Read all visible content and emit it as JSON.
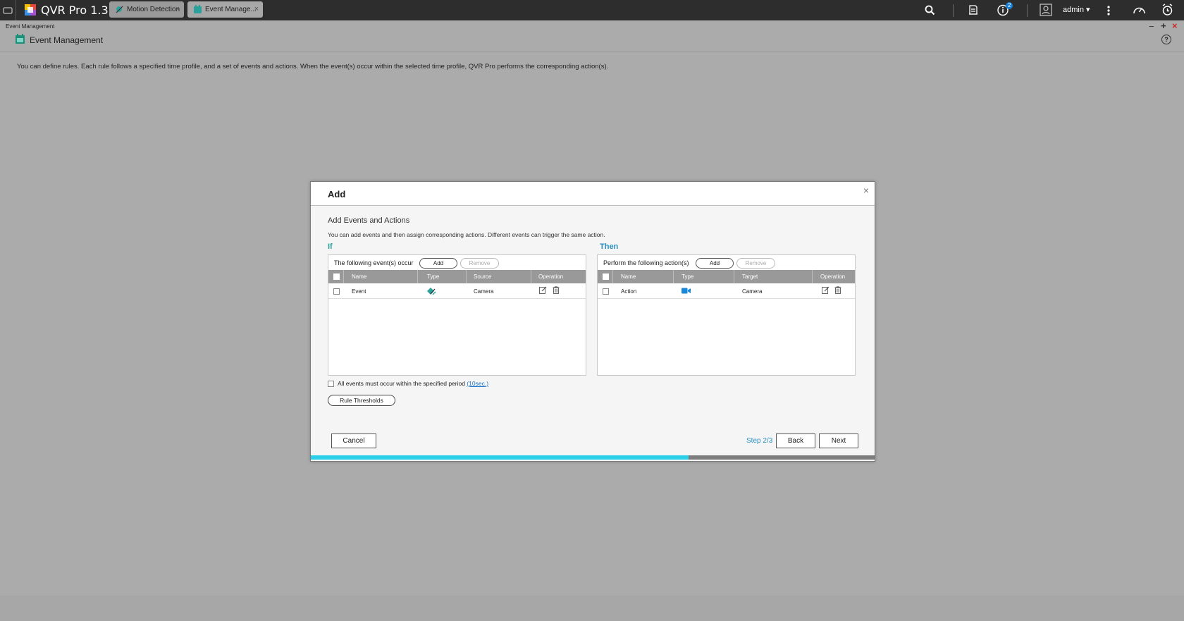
{
  "app": {
    "title": "QVR Pro 1.3"
  },
  "tabs": [
    {
      "label": "Motion Detection",
      "close": "×"
    },
    {
      "label": "Event Manage...",
      "close": "×"
    }
  ],
  "topbar": {
    "notification_count": "2",
    "user": "admin ▾"
  },
  "window": {
    "breadcrumb": "Event Management",
    "title": "Event Management",
    "help": "?"
  },
  "page": {
    "description": "You can define rules. Each rule follows a specified time profile, and a set of events and actions. When the event(s) occur within the selected time profile, QVR Pro performs the corresponding action(s)."
  },
  "dialog": {
    "title": "Add",
    "close": "×",
    "subtitle": "Add Events and Actions",
    "note": "You can add events and then assign corresponding actions. Different events can trigger the same action.",
    "if_section": {
      "heading": "If",
      "label": "The following event(s) occur",
      "add": "Add",
      "remove": "Remove",
      "columns": [
        "Name",
        "Type",
        "Source",
        "Operation"
      ],
      "rows": [
        {
          "name": "Event",
          "type_icon": "motion-detection-icon",
          "source": "Camera"
        }
      ]
    },
    "then_section": {
      "heading": "Then",
      "label": "Perform the following action(s)",
      "add": "Add",
      "remove": "Remove",
      "columns": [
        "Name",
        "Type",
        "Target",
        "Operation"
      ],
      "rows": [
        {
          "name": "Action",
          "type_icon": "video-camera-icon",
          "target": "Camera"
        }
      ]
    },
    "all_events_label": "All events must occur within the specified period",
    "period_link": "(10sec.)",
    "rule_thresholds": "Rule Thresholds",
    "cancel": "Cancel",
    "step": "Step 2/3",
    "back": "Back",
    "next": "Next",
    "progress": 0.67
  },
  "colors": {
    "accent_teal": "#2aa19b",
    "accent_blue": "#2a8fc0",
    "progress": "#29d0e8"
  }
}
